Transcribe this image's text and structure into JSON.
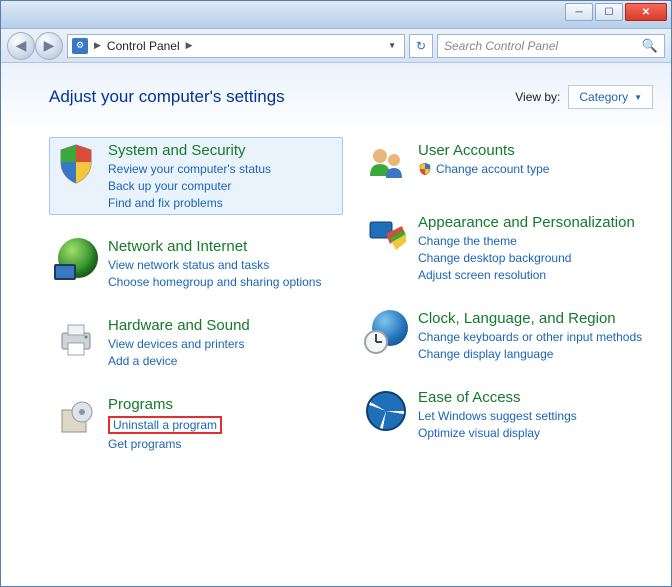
{
  "titlebar": {
    "minimize": "─",
    "maximize": "☐",
    "close": "✕"
  },
  "address": {
    "crumb1": "Control Panel",
    "sep": "▶",
    "refresh": "↻",
    "search_placeholder": "Search Control Panel"
  },
  "heading": "Adjust your computer's settings",
  "viewby": {
    "label": "View by:",
    "value": "Category"
  },
  "categories": {
    "system_security": {
      "title": "System and Security",
      "links": [
        "Review your computer's status",
        "Back up your computer",
        "Find and fix problems"
      ]
    },
    "network": {
      "title": "Network and Internet",
      "links": [
        "View network status and tasks",
        "Choose homegroup and sharing options"
      ]
    },
    "hardware": {
      "title": "Hardware and Sound",
      "links": [
        "View devices and printers",
        "Add a device"
      ]
    },
    "programs": {
      "title": "Programs",
      "links": [
        "Uninstall a program",
        "Get programs"
      ]
    },
    "users": {
      "title": "User Accounts",
      "links": [
        "Change account type"
      ]
    },
    "appearance": {
      "title": "Appearance and Personalization",
      "links": [
        "Change the theme",
        "Change desktop background",
        "Adjust screen resolution"
      ]
    },
    "clock": {
      "title": "Clock, Language, and Region",
      "links": [
        "Change keyboards or other input methods",
        "Change display language"
      ]
    },
    "ease": {
      "title": "Ease of Access",
      "links": [
        "Let Windows suggest settings",
        "Optimize visual display"
      ]
    }
  }
}
